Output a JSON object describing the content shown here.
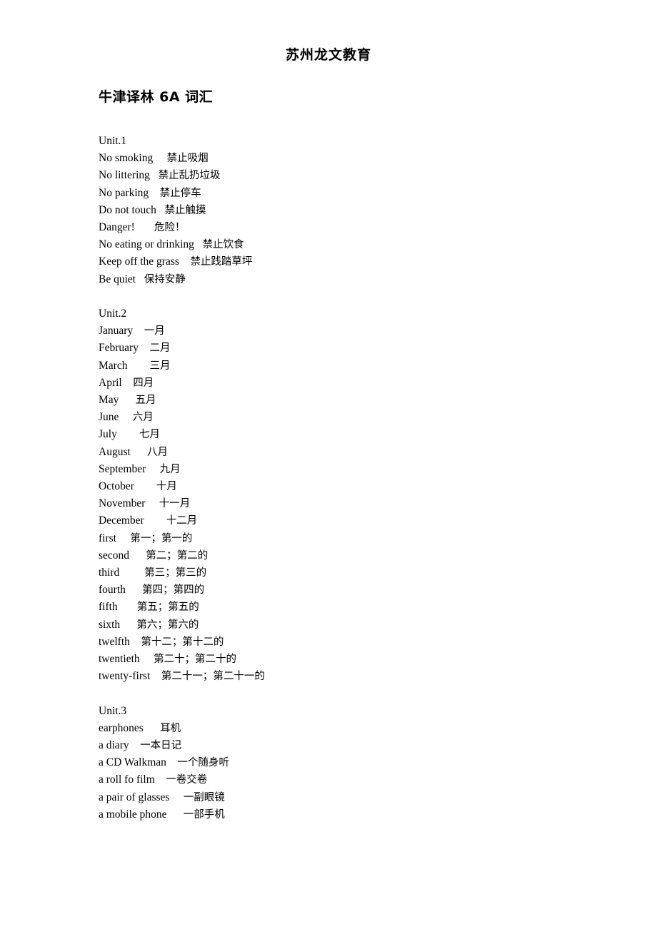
{
  "header": {
    "org_name": "苏州龙文教育"
  },
  "title": "牛津译林  6A 词汇",
  "units": [
    {
      "label": "Unit.1",
      "entries": [
        {
          "en": "No smoking",
          "gap": "     ",
          "cn": "禁止吸烟"
        },
        {
          "en": "No littering",
          "gap": "   ",
          "cn": "禁止乱扔垃圾"
        },
        {
          "en": "No parking",
          "gap": "    ",
          "cn": "禁止停车"
        },
        {
          "en": "Do not touch",
          "gap": "   ",
          "cn": "禁止触摸"
        },
        {
          "en": "Danger!",
          "gap": "       ",
          "cn": "危险！"
        },
        {
          "en": "No eating or drinking",
          "gap": "   ",
          "cn": "禁止饮食"
        },
        {
          "en": "Keep off the grass",
          "gap": "    ",
          "cn": "禁止践踏草坪"
        },
        {
          "en": "Be quiet",
          "gap": "   ",
          "cn": "保持安静"
        }
      ]
    },
    {
      "label": "Unit.2",
      "entries": [
        {
          "en": "January",
          "gap": "    ",
          "cn": "一月"
        },
        {
          "en": "February",
          "gap": "    ",
          "cn": "二月"
        },
        {
          "en": "March",
          "gap": "        ",
          "cn": "三月"
        },
        {
          "en": "April",
          "gap": "    ",
          "cn": "四月"
        },
        {
          "en": "May",
          "gap": "      ",
          "cn": "五月"
        },
        {
          "en": "June",
          "gap": "     ",
          "cn": "六月"
        },
        {
          "en": "July",
          "gap": "        ",
          "cn": "七月"
        },
        {
          "en": "August",
          "gap": "      ",
          "cn": "八月"
        },
        {
          "en": "September",
          "gap": "     ",
          "cn": "九月"
        },
        {
          "en": "October",
          "gap": "        ",
          "cn": "十月"
        },
        {
          "en": "November",
          "gap": "     ",
          "cn": "十一月"
        },
        {
          "en": "December",
          "gap": "        ",
          "cn": "十二月"
        },
        {
          "en": "first",
          "gap": "     ",
          "cn": "第一；第一的"
        },
        {
          "en": "second",
          "gap": "      ",
          "cn": "第二；第二的"
        },
        {
          "en": "third",
          "gap": "         ",
          "cn": "第三；第三的"
        },
        {
          "en": "fourth",
          "gap": "      ",
          "cn": "第四；第四的"
        },
        {
          "en": "fifth",
          "gap": "       ",
          "cn": "第五；第五的"
        },
        {
          "en": "sixth",
          "gap": "      ",
          "cn": "第六；第六的"
        },
        {
          "en": "twelfth",
          "gap": "    ",
          "cn": "第十二；第十二的"
        },
        {
          "en": "twentieth",
          "gap": "     ",
          "cn": "第二十；第二十的"
        },
        {
          "en": "twenty-first",
          "gap": "    ",
          "cn": "第二十一；第二十一的"
        }
      ]
    },
    {
      "label": "Unit.3",
      "entries": [
        {
          "en": "earphones",
          "gap": "      ",
          "cn": "耳机"
        },
        {
          "en": "a diary",
          "gap": "    ",
          "cn": "一本日记"
        },
        {
          "en": "a CD Walkman",
          "gap": "    ",
          "cn": "一个随身听"
        },
        {
          "en": "a roll fo film",
          "gap": "    ",
          "cn": "一卷交卷"
        },
        {
          "en": "a pair of glasses",
          "gap": "     ",
          "cn": "一副眼镜"
        },
        {
          "en": "a mobile phone",
          "gap": "      ",
          "cn": "一部手机"
        }
      ]
    }
  ]
}
